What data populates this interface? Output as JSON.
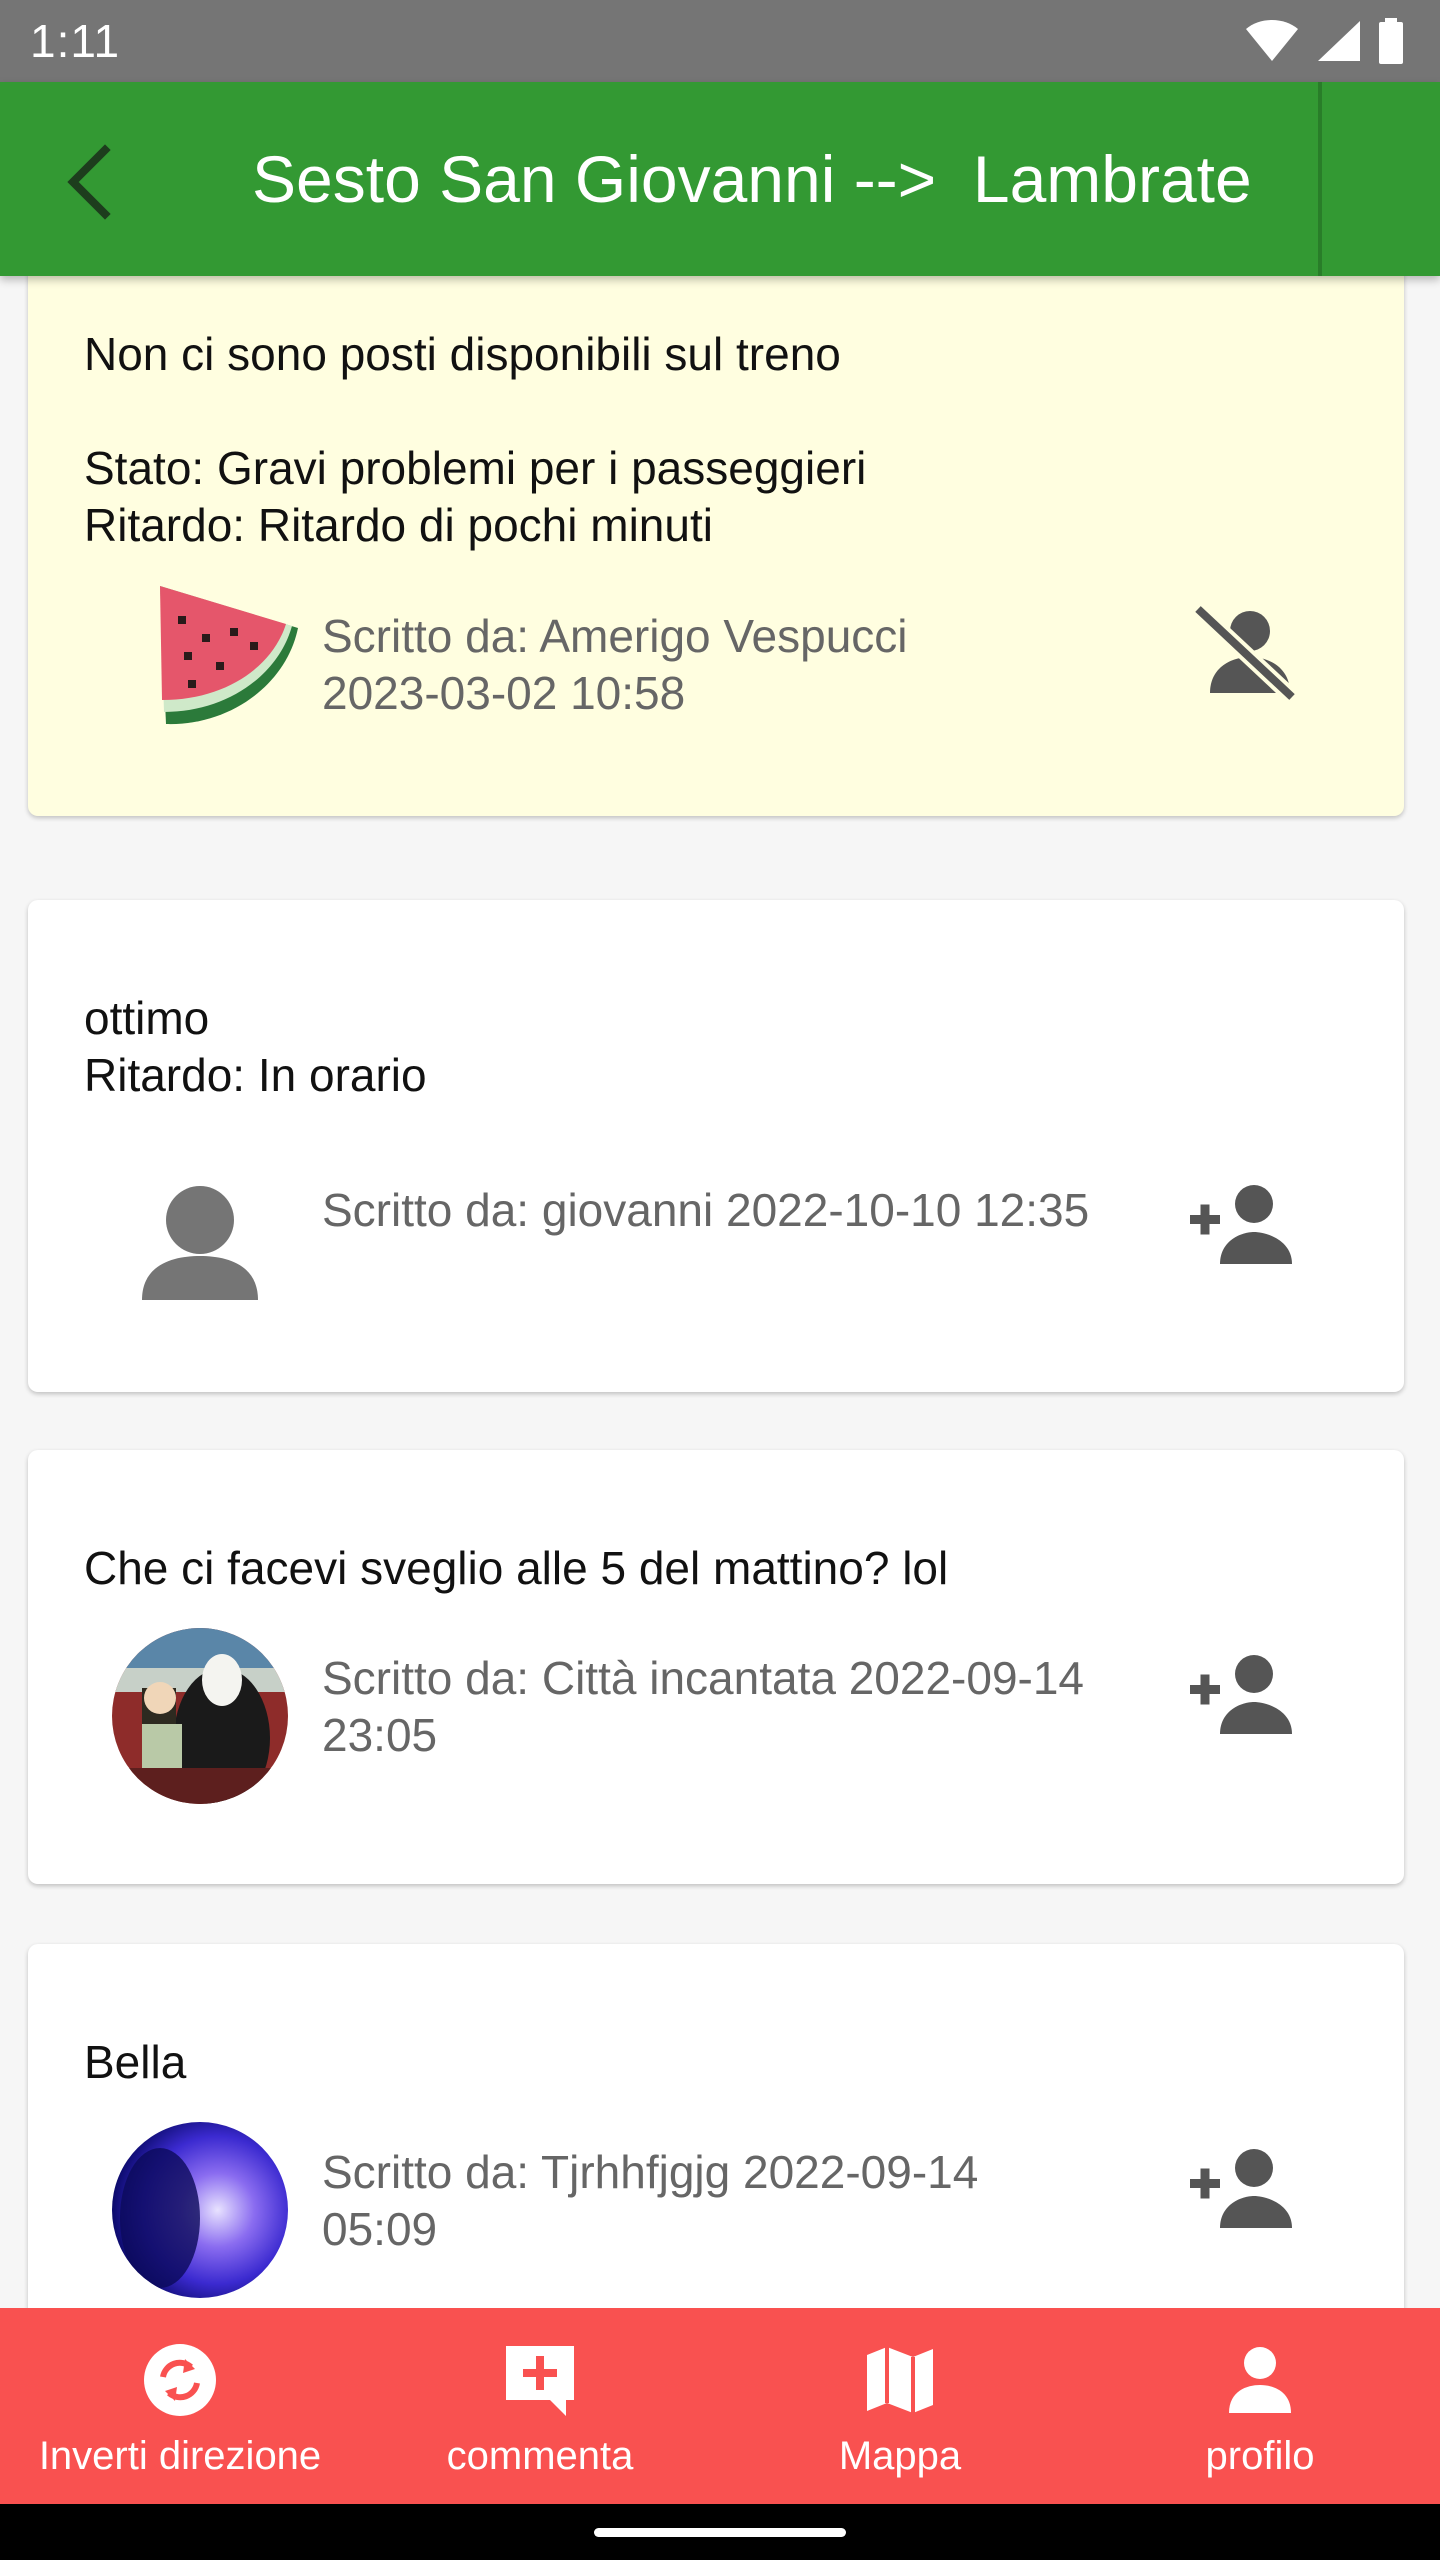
{
  "status_bar": {
    "time": "1:11"
  },
  "app_bar": {
    "title": "Sesto San Giovanni -->  Lambrate"
  },
  "posts": [
    {
      "text": "Non ci sono posti disponibili sul treno\n\nStato: Gravi problemi per i passeggieri\nRitardo: Ritardo di pochi minuti",
      "meta": "Scritto da: Amerigo Vespucci\n2023-03-02 10:58",
      "avatar": "watermelon-avatar",
      "action_icon": "unfollow-user-icon",
      "highlight_color": "#fffee0"
    },
    {
      "text": "ottimo\nRitardo: In orario",
      "meta": "Scritto da: giovanni 2022-10-10 12:35",
      "avatar": "default-person-avatar",
      "action_icon": "add-user-icon"
    },
    {
      "text": "Che ci facevi sveglio alle 5 del mattino? lol",
      "meta": "Scritto da: Città incantata 2022-09-14\n23:05",
      "avatar": "photo-avatar",
      "action_icon": "add-user-icon"
    },
    {
      "text": "Bella",
      "meta": "Scritto da: Tjrhhfjgjg 2022-09-14\n05:09",
      "avatar": "photo-avatar",
      "action_icon": "add-user-icon"
    }
  ],
  "bottom_nav": [
    {
      "label": "Inverti direzione",
      "icon": "swap-direction-icon"
    },
    {
      "label": "commenta",
      "icon": "add-comment-icon"
    },
    {
      "label": "Mappa",
      "icon": "map-icon"
    },
    {
      "label": "profilo",
      "icon": "person-icon"
    }
  ],
  "colors": {
    "app_bar": "#339933",
    "bottom_nav": "#f95150",
    "status_bar": "#757575",
    "warning_card": "#fffee0"
  }
}
